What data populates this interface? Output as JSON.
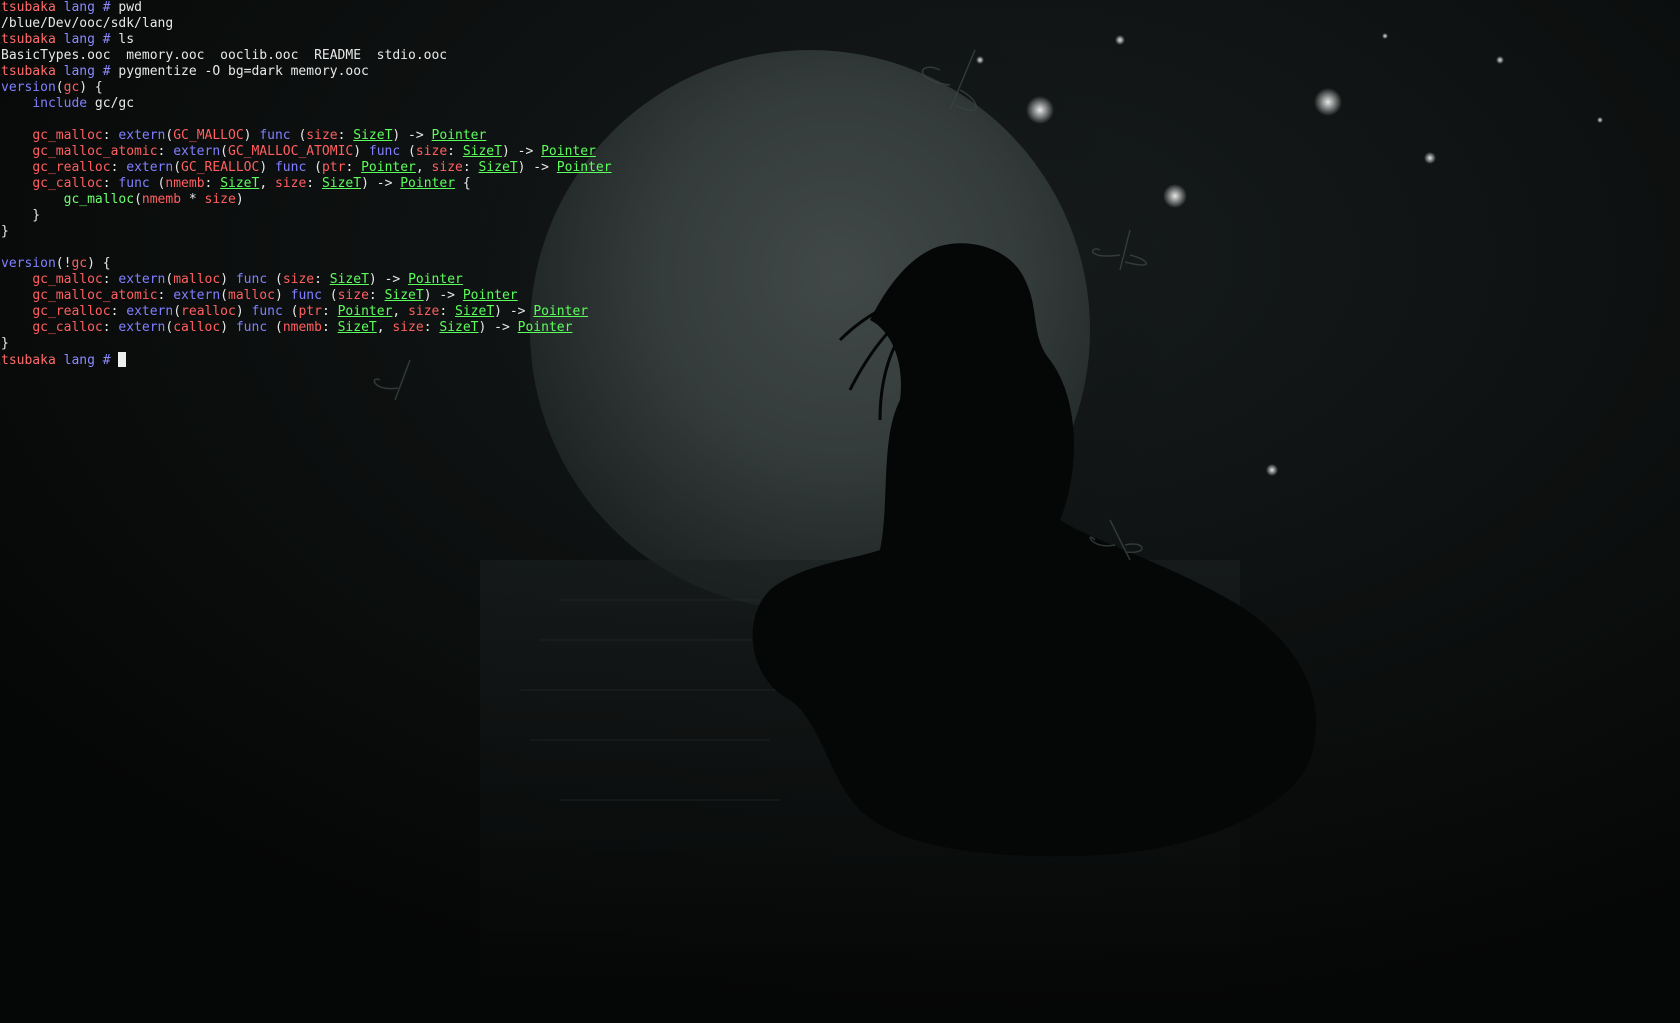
{
  "app": {
    "type": "terminal",
    "host": "tsubaka",
    "cwd_name": "lang",
    "prompt_symbol": "#"
  },
  "colors": {
    "prompt_host": "#ff6b6b",
    "prompt_dir": "#8a8aff",
    "prompt_hash": "#8a8aff",
    "plain": "#e8e8e8",
    "keyword": "#8080ff",
    "identifier_red": "#ff5f5f",
    "type_green": "#5cff5c",
    "green_call": "#6cff6c"
  },
  "icons": {
    "cursor": "block-cursor-icon",
    "wallpaper": "moon-silhouette-wallpaper-icon"
  },
  "terminal_lines": [
    [
      {
        "t": "tsubaka",
        "c": "prompt_host"
      },
      {
        "t": " lang",
        "c": "prompt_dir"
      },
      {
        "t": " #",
        "c": "prompt_hash"
      },
      {
        "t": " pwd",
        "c": "plain"
      }
    ],
    [
      {
        "t": "/blue/Dev/ooc/sdk/lang",
        "c": "plain"
      }
    ],
    [
      {
        "t": "tsubaka",
        "c": "prompt_host"
      },
      {
        "t": " lang",
        "c": "prompt_dir"
      },
      {
        "t": " #",
        "c": "prompt_hash"
      },
      {
        "t": " ls",
        "c": "plain"
      }
    ],
    [
      {
        "t": "BasicTypes.ooc  memory.ooc  ooclib.ooc  README  stdio.ooc",
        "c": "plain"
      }
    ],
    [
      {
        "t": "tsubaka",
        "c": "prompt_host"
      },
      {
        "t": " lang",
        "c": "prompt_dir"
      },
      {
        "t": " #",
        "c": "prompt_hash"
      },
      {
        "t": " pygmentize -O bg=dark memory.ooc",
        "c": "plain"
      }
    ],
    [
      {
        "t": "version",
        "c": "keyword"
      },
      {
        "t": "(",
        "c": "plain"
      },
      {
        "t": "gc",
        "c": "identifier_red"
      },
      {
        "t": ") {",
        "c": "plain"
      }
    ],
    [
      {
        "t": "    ",
        "c": "plain"
      },
      {
        "t": "include",
        "c": "keyword"
      },
      {
        "t": " gc/gc",
        "c": "plain"
      }
    ],
    [
      {
        "t": "",
        "c": "plain"
      }
    ],
    [
      {
        "t": "    ",
        "c": "plain"
      },
      {
        "t": "gc_malloc",
        "c": "identifier_red"
      },
      {
        "t": ": ",
        "c": "plain"
      },
      {
        "t": "extern",
        "c": "keyword"
      },
      {
        "t": "(",
        "c": "plain"
      },
      {
        "t": "GC_MALLOC",
        "c": "identifier_red"
      },
      {
        "t": ") ",
        "c": "plain"
      },
      {
        "t": "func",
        "c": "keyword"
      },
      {
        "t": " (",
        "c": "plain"
      },
      {
        "t": "size",
        "c": "identifier_red"
      },
      {
        "t": ": ",
        "c": "plain"
      },
      {
        "t": "SizeT",
        "c": "type_green",
        "u": true
      },
      {
        "t": ") -> ",
        "c": "plain"
      },
      {
        "t": "Pointer",
        "c": "type_green",
        "u": true
      }
    ],
    [
      {
        "t": "    ",
        "c": "plain"
      },
      {
        "t": "gc_malloc_atomic",
        "c": "identifier_red"
      },
      {
        "t": ": ",
        "c": "plain"
      },
      {
        "t": "extern",
        "c": "keyword"
      },
      {
        "t": "(",
        "c": "plain"
      },
      {
        "t": "GC_MALLOC_ATOMIC",
        "c": "identifier_red"
      },
      {
        "t": ") ",
        "c": "plain"
      },
      {
        "t": "func",
        "c": "keyword"
      },
      {
        "t": " (",
        "c": "plain"
      },
      {
        "t": "size",
        "c": "identifier_red"
      },
      {
        "t": ": ",
        "c": "plain"
      },
      {
        "t": "SizeT",
        "c": "type_green",
        "u": true
      },
      {
        "t": ") -> ",
        "c": "plain"
      },
      {
        "t": "Pointer",
        "c": "type_green",
        "u": true
      }
    ],
    [
      {
        "t": "    ",
        "c": "plain"
      },
      {
        "t": "gc_realloc",
        "c": "identifier_red"
      },
      {
        "t": ": ",
        "c": "plain"
      },
      {
        "t": "extern",
        "c": "keyword"
      },
      {
        "t": "(",
        "c": "plain"
      },
      {
        "t": "GC_REALLOC",
        "c": "identifier_red"
      },
      {
        "t": ") ",
        "c": "plain"
      },
      {
        "t": "func",
        "c": "keyword"
      },
      {
        "t": " (",
        "c": "plain"
      },
      {
        "t": "ptr",
        "c": "identifier_red"
      },
      {
        "t": ": ",
        "c": "plain"
      },
      {
        "t": "Pointer",
        "c": "type_green",
        "u": true
      },
      {
        "t": ", ",
        "c": "plain"
      },
      {
        "t": "size",
        "c": "identifier_red"
      },
      {
        "t": ": ",
        "c": "plain"
      },
      {
        "t": "SizeT",
        "c": "type_green",
        "u": true
      },
      {
        "t": ") -> ",
        "c": "plain"
      },
      {
        "t": "Pointer",
        "c": "type_green",
        "u": true
      }
    ],
    [
      {
        "t": "    ",
        "c": "plain"
      },
      {
        "t": "gc_calloc",
        "c": "identifier_red"
      },
      {
        "t": ": ",
        "c": "plain"
      },
      {
        "t": "func",
        "c": "keyword"
      },
      {
        "t": " (",
        "c": "plain"
      },
      {
        "t": "nmemb",
        "c": "identifier_red"
      },
      {
        "t": ": ",
        "c": "plain"
      },
      {
        "t": "SizeT",
        "c": "type_green",
        "u": true
      },
      {
        "t": ", ",
        "c": "plain"
      },
      {
        "t": "size",
        "c": "identifier_red"
      },
      {
        "t": ": ",
        "c": "plain"
      },
      {
        "t": "SizeT",
        "c": "type_green",
        "u": true
      },
      {
        "t": ") -> ",
        "c": "plain"
      },
      {
        "t": "Pointer",
        "c": "type_green",
        "u": true
      },
      {
        "t": " {",
        "c": "plain"
      }
    ],
    [
      {
        "t": "        ",
        "c": "plain"
      },
      {
        "t": "gc_malloc",
        "c": "green_call"
      },
      {
        "t": "(",
        "c": "plain"
      },
      {
        "t": "nmemb",
        "c": "identifier_red"
      },
      {
        "t": " * ",
        "c": "plain"
      },
      {
        "t": "size",
        "c": "identifier_red"
      },
      {
        "t": ")",
        "c": "plain"
      }
    ],
    [
      {
        "t": "    }",
        "c": "plain"
      }
    ],
    [
      {
        "t": "}",
        "c": "plain"
      }
    ],
    [
      {
        "t": "",
        "c": "plain"
      }
    ],
    [
      {
        "t": "version",
        "c": "keyword"
      },
      {
        "t": "(!",
        "c": "plain"
      },
      {
        "t": "gc",
        "c": "identifier_red"
      },
      {
        "t": ") {",
        "c": "plain"
      }
    ],
    [
      {
        "t": "    ",
        "c": "plain"
      },
      {
        "t": "gc_malloc",
        "c": "identifier_red"
      },
      {
        "t": ": ",
        "c": "plain"
      },
      {
        "t": "extern",
        "c": "keyword"
      },
      {
        "t": "(",
        "c": "plain"
      },
      {
        "t": "malloc",
        "c": "identifier_red"
      },
      {
        "t": ") ",
        "c": "plain"
      },
      {
        "t": "func",
        "c": "keyword"
      },
      {
        "t": " (",
        "c": "plain"
      },
      {
        "t": "size",
        "c": "identifier_red"
      },
      {
        "t": ": ",
        "c": "plain"
      },
      {
        "t": "SizeT",
        "c": "type_green",
        "u": true
      },
      {
        "t": ") -> ",
        "c": "plain"
      },
      {
        "t": "Pointer",
        "c": "type_green",
        "u": true
      }
    ],
    [
      {
        "t": "    ",
        "c": "plain"
      },
      {
        "t": "gc_malloc_atomic",
        "c": "identifier_red"
      },
      {
        "t": ": ",
        "c": "plain"
      },
      {
        "t": "extern",
        "c": "keyword"
      },
      {
        "t": "(",
        "c": "plain"
      },
      {
        "t": "malloc",
        "c": "identifier_red"
      },
      {
        "t": ") ",
        "c": "plain"
      },
      {
        "t": "func",
        "c": "keyword"
      },
      {
        "t": " (",
        "c": "plain"
      },
      {
        "t": "size",
        "c": "identifier_red"
      },
      {
        "t": ": ",
        "c": "plain"
      },
      {
        "t": "SizeT",
        "c": "type_green",
        "u": true
      },
      {
        "t": ") -> ",
        "c": "plain"
      },
      {
        "t": "Pointer",
        "c": "type_green",
        "u": true
      }
    ],
    [
      {
        "t": "    ",
        "c": "plain"
      },
      {
        "t": "gc_realloc",
        "c": "identifier_red"
      },
      {
        "t": ": ",
        "c": "plain"
      },
      {
        "t": "extern",
        "c": "keyword"
      },
      {
        "t": "(",
        "c": "plain"
      },
      {
        "t": "realloc",
        "c": "identifier_red"
      },
      {
        "t": ") ",
        "c": "plain"
      },
      {
        "t": "func",
        "c": "keyword"
      },
      {
        "t": " (",
        "c": "plain"
      },
      {
        "t": "ptr",
        "c": "identifier_red"
      },
      {
        "t": ": ",
        "c": "plain"
      },
      {
        "t": "Pointer",
        "c": "type_green",
        "u": true
      },
      {
        "t": ", ",
        "c": "plain"
      },
      {
        "t": "size",
        "c": "identifier_red"
      },
      {
        "t": ": ",
        "c": "plain"
      },
      {
        "t": "SizeT",
        "c": "type_green",
        "u": true
      },
      {
        "t": ") -> ",
        "c": "plain"
      },
      {
        "t": "Pointer",
        "c": "type_green",
        "u": true
      }
    ],
    [
      {
        "t": "    ",
        "c": "plain"
      },
      {
        "t": "gc_calloc",
        "c": "identifier_red"
      },
      {
        "t": ": ",
        "c": "plain"
      },
      {
        "t": "extern",
        "c": "keyword"
      },
      {
        "t": "(",
        "c": "plain"
      },
      {
        "t": "calloc",
        "c": "identifier_red"
      },
      {
        "t": ") ",
        "c": "plain"
      },
      {
        "t": "func",
        "c": "keyword"
      },
      {
        "t": " (",
        "c": "plain"
      },
      {
        "t": "nmemb",
        "c": "identifier_red"
      },
      {
        "t": ": ",
        "c": "plain"
      },
      {
        "t": "SizeT",
        "c": "type_green",
        "u": true
      },
      {
        "t": ", ",
        "c": "plain"
      },
      {
        "t": "size",
        "c": "identifier_red"
      },
      {
        "t": ": ",
        "c": "plain"
      },
      {
        "t": "SizeT",
        "c": "type_green",
        "u": true
      },
      {
        "t": ") -> ",
        "c": "plain"
      },
      {
        "t": "Pointer",
        "c": "type_green",
        "u": true
      }
    ],
    [
      {
        "t": "}",
        "c": "plain"
      }
    ],
    [
      {
        "t": "tsubaka",
        "c": "prompt_host"
      },
      {
        "t": " lang",
        "c": "prompt_dir"
      },
      {
        "t": " #",
        "c": "prompt_hash"
      },
      {
        "t": " ",
        "c": "plain"
      },
      {
        "cursor": true
      }
    ]
  ]
}
